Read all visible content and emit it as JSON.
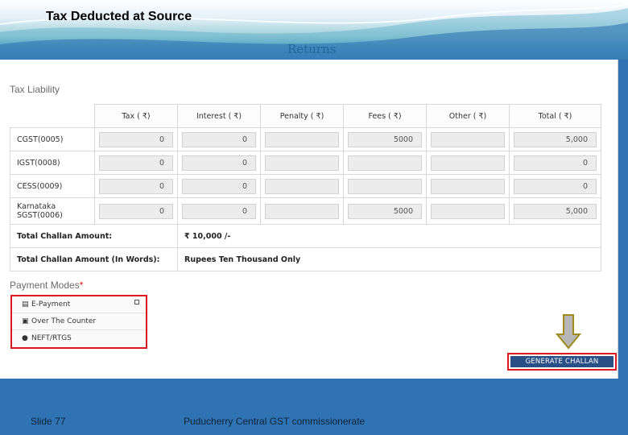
{
  "slide": {
    "title": "Tax Deducted at Source",
    "subtitle": "Returns",
    "number": "Slide 77",
    "footer": "Puducherry Central GST commissionerate"
  },
  "tax_liability": {
    "label": "Tax Liability",
    "columns": [
      "Tax ( ₹)",
      "Interest ( ₹)",
      "Penalty ( ₹)",
      "Fees ( ₹)",
      "Other ( ₹)",
      "Total ( ₹)"
    ],
    "rows": [
      {
        "name": "CGST(0005)",
        "tax": "0",
        "interest": "0",
        "penalty": "",
        "fees": "5000",
        "other": "",
        "total": "5,000"
      },
      {
        "name": "IGST(0008)",
        "tax": "0",
        "interest": "0",
        "penalty": "",
        "fees": "",
        "other": "",
        "total": "0"
      },
      {
        "name": "CESS(0009)",
        "tax": "0",
        "interest": "0",
        "penalty": "",
        "fees": "",
        "other": "",
        "total": "0"
      },
      {
        "name": "Karnataka SGST(0006)",
        "tax": "0",
        "interest": "0",
        "penalty": "",
        "fees": "5000",
        "other": "",
        "total": "5,000"
      }
    ],
    "total_amount_label": "Total Challan Amount:",
    "total_amount_value": "₹ 10,000 /-",
    "total_words_label": "Total Challan Amount (In Words):",
    "total_words_value": "Rupees Ten Thousand Only"
  },
  "payment": {
    "label": "Payment Modes",
    "required_mark": "*",
    "modes": [
      {
        "icon": "card-icon",
        "label": "E-Payment"
      },
      {
        "icon": "counter-icon",
        "label": "Over The Counter"
      },
      {
        "icon": "globe-icon",
        "label": "NEFT/RTGS"
      }
    ]
  },
  "generate_label": "GENERATE CHALLAN",
  "colors": {
    "accent_red": "#d91820",
    "button_blue": "#2a4f86",
    "slide_blue": "#2f73b3"
  }
}
